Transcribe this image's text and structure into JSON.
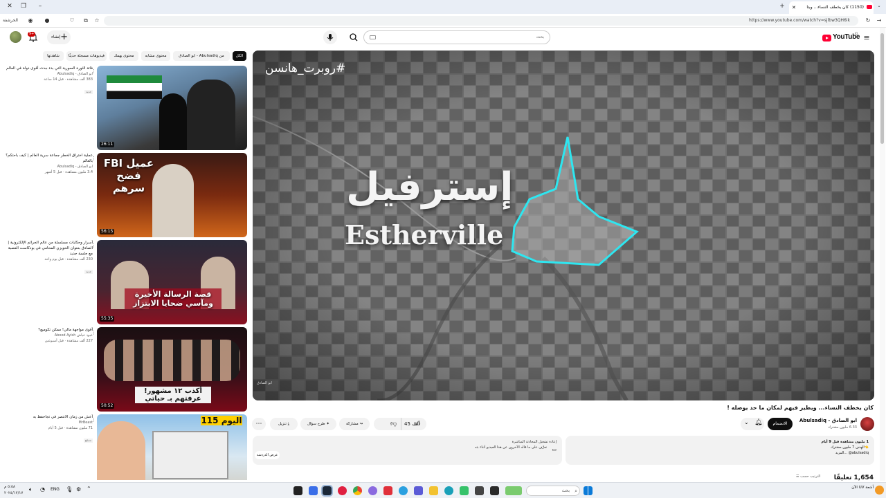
{
  "browser": {
    "tab_title": "(1150) كان يخطف النساء... ويتا",
    "url": "https://www.youtube.com/watch?v=sjlbw3QH6ik",
    "profile_label": "الخرشفة"
  },
  "header": {
    "logo_text": "YouTube",
    "logo_sup": "JO",
    "search_placeholder": "بحث",
    "create_label": "إنشاء",
    "notification_count": "9+"
  },
  "chips": [
    {
      "label": "الكل",
      "active": true
    },
    {
      "label": "من Abulsadiq - ابو الصادق",
      "active": false
    },
    {
      "label": "محتوى مشابه",
      "active": false
    },
    {
      "label": "محتوى يهمك",
      "active": false
    },
    {
      "label": "فيديوهات مسجلة حديثًا",
      "active": false
    },
    {
      "label": "شاهدتها",
      "active": false
    }
  ],
  "player": {
    "hashtag": "#روبرت_هانسن",
    "overlay_arabic": "إسترفيل",
    "overlay_english": "Estherville",
    "watermark": "ابو الصادق"
  },
  "video": {
    "title": "كان يخطف النساء... ويطير فيهم لمكان ما حد يوصله !",
    "channel_name": "ابو الصادق - Abulsadiq",
    "channel_subs": "6.33 مليون مشترك",
    "join_label": "الانضمام",
    "likes": "45 ألف",
    "share_label": "مشاركة",
    "ask_label": "طرح سؤال",
    "download_label": "تنزيل"
  },
  "description": {
    "line1": "1 مليون مشاهدة قبل 9 أيام",
    "line2": "👈الهدف 7 مليون مشترك",
    "line3": "abulsadiq@ ...المزيد"
  },
  "ai_box": {
    "line1": "إعادة تشغيل المحادثة المباشرة",
    "line2": "تعرَّف على ما قاله الآخرون عن هذا الفيديو أثناء بثه",
    "question": "عرض الدردشة"
  },
  "comments": {
    "count": "1,654 تعليقًا",
    "sort_label": "الترتيب حسب"
  },
  "recommendations": [
    {
      "title": "فاتة الثورة السورية التي بدء جدت أقوى دولة في العالم",
      "channel": "ابو الصادق - Abulsadiq",
      "meta": "383 ألف مشاهدة · قبل 14 ساعة",
      "badge": "جديد",
      "duration": "26:11",
      "thumb_text": ""
    },
    {
      "title": "عملية اختراق الخطر جماعة سرية العالم | كيف باحتكم؟ بالعالم",
      "channel": "ابو الصادق - Abulsadiq",
      "meta": "3.4 مليون مشاهدة · قبل 5 أشهر",
      "badge": "",
      "duration": "56:15",
      "thumb_text": "عميل FBI فضح سرهم"
    },
    {
      "title": "أسرار وحكايات مسلسلة من عالم الجرائم الإلكترونية | الصادق بعنوان الحويزي المحامي في بودكاست العصبة مع جلسة جديد",
      "channel": "",
      "meta": "230 ألف مشاهدة · قبل يوم واحد",
      "badge": "جديد",
      "duration": "55:35",
      "thumb_text": "قصة الرسالة الأخيرة ومآسي ضحايا الابتزاز"
    },
    {
      "title": "أقوى مواجهة مالي! ممكن تكوميع؟",
      "channel": "عبود عياش Abood Ayish",
      "meta": "227 ألف مشاهدة · قبل أسبوعين",
      "badge": "",
      "duration": "50:52",
      "thumb_text": "أكذب ١٢ مشهور! عرفتهم بـ حياتي"
    },
    {
      "title": "أعش من زمان الانتصر في تجاحفظ به",
      "channel": "MrBeast",
      "meta": "71 مليون مشاهدة · قبل 5 أيام",
      "badge": "مدبلج",
      "duration": "",
      "thumb_text": "اليوم 115"
    }
  ],
  "taskbar": {
    "search_label": "بحث",
    "time": "٥:٥٨ م",
    "date": "٢٠٢٤/١٢/١٧",
    "lang": "ENG",
    "weather": "أشعة UV الآن"
  },
  "colors": {
    "youtube_red": "#ff0033",
    "chip_active_bg": "#0f0f0f",
    "chip_bg": "#f2f2f2",
    "player_teal": "#2ee6f0"
  }
}
